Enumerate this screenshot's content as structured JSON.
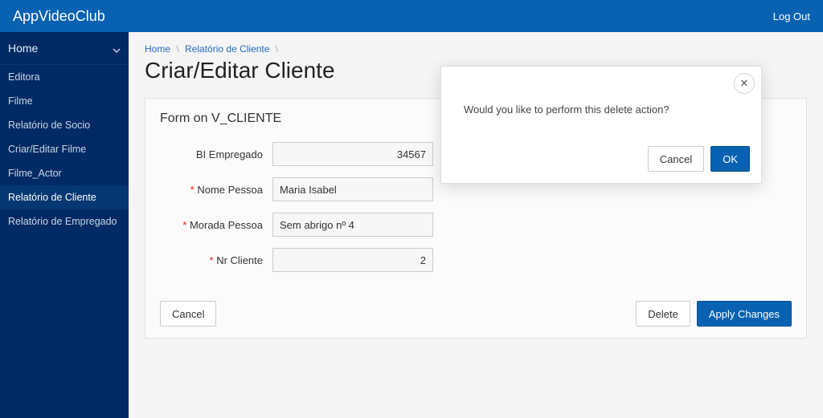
{
  "header": {
    "app_title": "AppVideoClub",
    "logout": "Log Out"
  },
  "sidebar": {
    "header_label": "Home",
    "items": [
      {
        "label": "Editora"
      },
      {
        "label": "Filme"
      },
      {
        "label": "Relatório de Socio"
      },
      {
        "label": "Criar/Editar Filme"
      },
      {
        "label": "Filme_Actor"
      },
      {
        "label": "Relatório de Cliente"
      },
      {
        "label": "Relatório de Empregado"
      }
    ],
    "active_index": 5
  },
  "breadcrumb": {
    "home": "Home",
    "section": "Relatório de Cliente"
  },
  "page": {
    "title": "Criar/Editar Cliente"
  },
  "form": {
    "region_title": "Form on V_CLIENTE",
    "fields": {
      "bi_empregado": {
        "label": "BI Empregado",
        "value": "34567",
        "required": false,
        "align": "right"
      },
      "nome_pessoa": {
        "label": "Nome Pessoa",
        "value": "Maria Isabel",
        "required": true,
        "align": "left"
      },
      "morada_pessoa": {
        "label": "Morada Pessoa",
        "value": "Sem abrigo nº 4",
        "required": true,
        "align": "left"
      },
      "nr_cliente": {
        "label": "Nr Cliente",
        "value": "2",
        "required": true,
        "align": "right"
      }
    },
    "buttons": {
      "cancel": "Cancel",
      "delete": "Delete",
      "apply": "Apply Changes"
    }
  },
  "dialog": {
    "message": "Would you like to perform this delete action?",
    "cancel": "Cancel",
    "ok": "OK",
    "close_symbol": "✕"
  }
}
